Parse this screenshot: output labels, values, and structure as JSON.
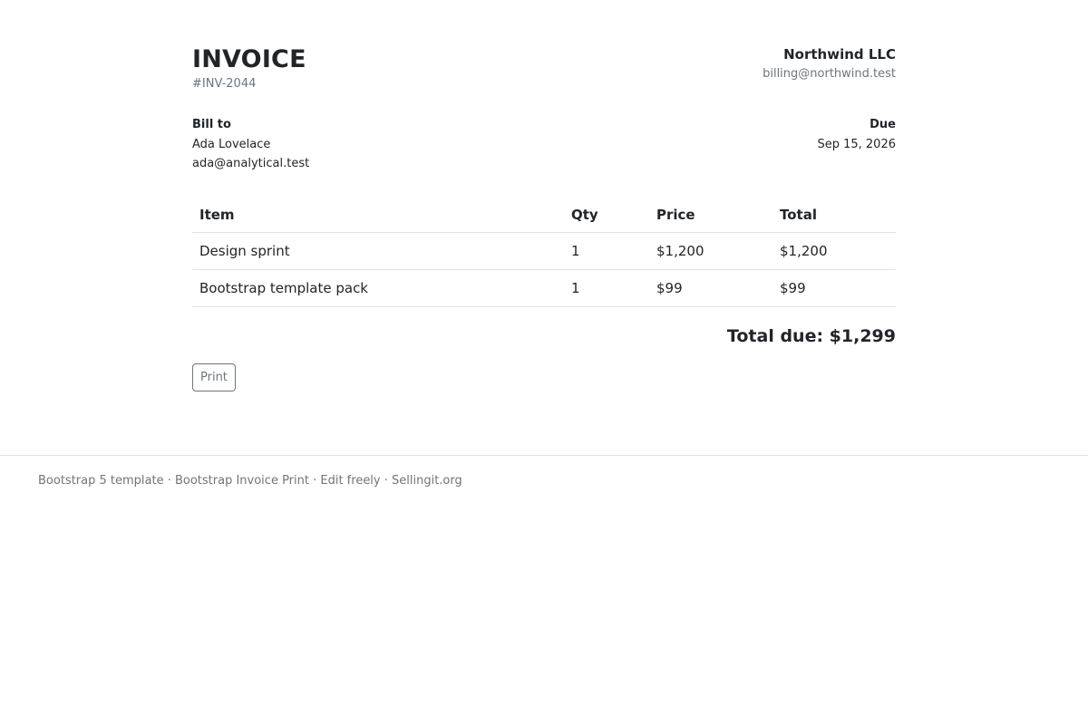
{
  "invoice": {
    "title": "INVOICE",
    "number": "#INV-2044"
  },
  "company": {
    "name": "Northwind LLC",
    "email": "billing@northwind.test"
  },
  "bill_to": {
    "label": "Bill to",
    "name": "Ada Lovelace",
    "email": "ada@analytical.test"
  },
  "due": {
    "label": "Due",
    "date": "Sep 15, 2026"
  },
  "table": {
    "headers": {
      "item": "Item",
      "qty": "Qty",
      "price": "Price",
      "total": "Total"
    },
    "rows": [
      {
        "item": "Design sprint",
        "qty": "1",
        "price": "$1,200",
        "total": "$1,200"
      },
      {
        "item": "Bootstrap template pack",
        "qty": "1",
        "price": "$99",
        "total": "$99"
      }
    ]
  },
  "total_due": "Total due: $1,299",
  "actions": {
    "print_label": "Print"
  },
  "footer": {
    "text": "Bootstrap 5 template · Bootstrap Invoice Print · Edit freely · Sellingit.org"
  }
}
